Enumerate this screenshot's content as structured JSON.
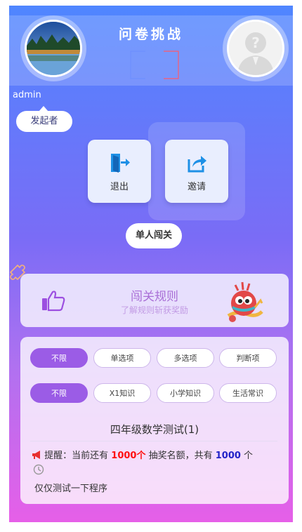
{
  "header": {
    "title": "问卷挑战",
    "left_user": {
      "name": "admin",
      "role": "发起者"
    }
  },
  "actions": [
    {
      "label": "退出",
      "icon": "exit-icon"
    },
    {
      "label": "邀请",
      "icon": "share-icon"
    }
  ],
  "mode": {
    "label": "单人闯关"
  },
  "rules": {
    "title": "闯关规则",
    "subtitle": "了解规则斩获奖励"
  },
  "filters": {
    "question_types": [
      {
        "label": "不限",
        "active": true
      },
      {
        "label": "单选项",
        "active": false
      },
      {
        "label": "多选项",
        "active": false
      },
      {
        "label": "判断项",
        "active": false
      }
    ],
    "categories": [
      {
        "label": "不限",
        "active": true
      },
      {
        "label": "X1知识",
        "active": false
      },
      {
        "label": "小学知识",
        "active": false
      },
      {
        "label": "生活常识",
        "active": false
      }
    ]
  },
  "quiz": {
    "title": "四年级数学测试(1)",
    "reminder": {
      "prefix": "提醒：当前还有 ",
      "count_highlight": "1000个",
      "middle": " 抽奖名额，共有 ",
      "total": "1000",
      "suffix": " 个"
    },
    "description": "仅仅测试一下程序"
  },
  "colors": {
    "accent": "#9b5ce6",
    "reminder_red": "#ff1010",
    "reminder_blue": "#2323c8"
  }
}
